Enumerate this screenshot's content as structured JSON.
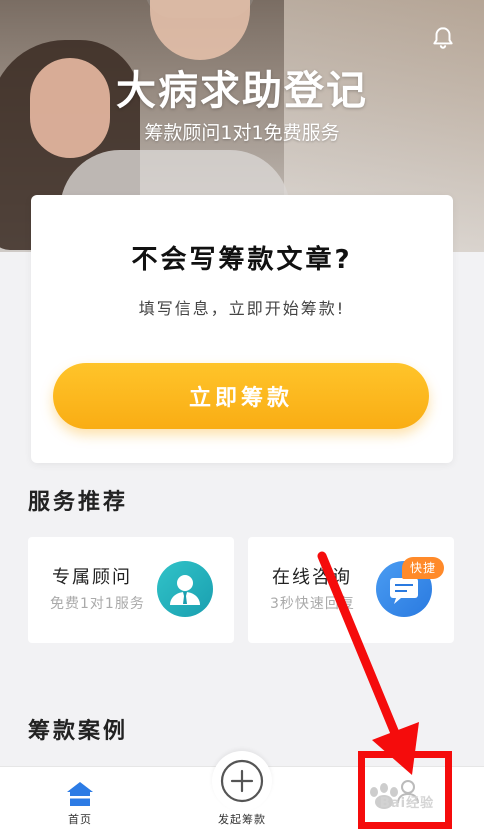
{
  "hero": {
    "title": "大病求助登记",
    "subtitle": "筹款顾问1对1免费服务",
    "notification_icon": "bell-icon"
  },
  "main_card": {
    "title": "不会写筹款文章?",
    "description": "填写信息，立即开始筹款!",
    "cta_label": "立即筹款",
    "cta_color": "#f9ad14"
  },
  "services": {
    "section_title": "服务推荐",
    "items": [
      {
        "name": "专属顾问",
        "desc": "免费1对1服务",
        "icon": "advisor-avatar-icon",
        "color": "#1a9fb0"
      },
      {
        "name": "在线咨询",
        "desc": "3秒快速回复",
        "icon": "chat-bubble-icon",
        "color": "#2a7ae0",
        "badge": "快捷"
      }
    ]
  },
  "cases": {
    "section_title": "筹款案例"
  },
  "tabbar": {
    "home_label": "首页",
    "start_label": "发起筹款",
    "active_color": "#2c7be5"
  },
  "annotation": {
    "color": "#f50c0c",
    "watermark": "Bai经验"
  }
}
